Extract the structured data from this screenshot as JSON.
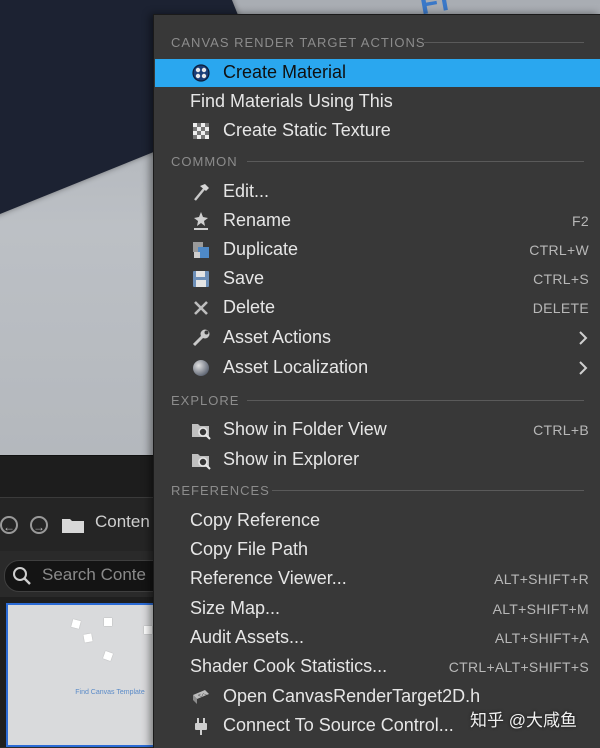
{
  "viewport": {
    "overlay_text": "Fi"
  },
  "content_browser": {
    "path_label": "Conten",
    "search_placeholder": "Search Conte",
    "thumbnail_title": "Find Canvas Template"
  },
  "menu": {
    "sections": [
      {
        "header": "CANVAS RENDER TARGET ACTIONS",
        "items": [
          {
            "label": "Create Material",
            "icon": "create-material-icon",
            "shortcut": "",
            "submenu": false,
            "highlighted": true
          },
          {
            "label": "Find Materials Using This",
            "icon": "",
            "shortcut": "",
            "submenu": false,
            "highlighted": false
          },
          {
            "label": "Create Static Texture",
            "icon": "static-texture-icon",
            "shortcut": "",
            "submenu": false,
            "highlighted": false
          }
        ]
      },
      {
        "header": "COMMON",
        "items": [
          {
            "label": "Edit...",
            "icon": "edit-hammer-icon",
            "shortcut": "",
            "submenu": false
          },
          {
            "label": "Rename",
            "icon": "rename-icon",
            "shortcut": "F2",
            "submenu": false
          },
          {
            "label": "Duplicate",
            "icon": "duplicate-icon",
            "shortcut": "CTRL+W",
            "submenu": false
          },
          {
            "label": "Save",
            "icon": "save-floppy-icon",
            "shortcut": "CTRL+S",
            "submenu": false
          },
          {
            "label": "Delete",
            "icon": "delete-x-icon",
            "shortcut": "DELETE",
            "submenu": false
          },
          {
            "label": "Asset Actions",
            "icon": "wrench-icon",
            "shortcut": "",
            "submenu": true
          },
          {
            "label": "Asset Localization",
            "icon": "globe-icon",
            "shortcut": "",
            "submenu": true
          }
        ]
      },
      {
        "header": "EXPLORE",
        "items": [
          {
            "label": "Show in Folder View",
            "icon": "folder-search-icon",
            "shortcut": "CTRL+B",
            "submenu": false
          },
          {
            "label": "Show in Explorer",
            "icon": "folder-search-icon",
            "shortcut": "",
            "submenu": false
          }
        ]
      },
      {
        "header": "REFERENCES",
        "items": [
          {
            "label": "Copy Reference",
            "icon": "",
            "shortcut": "",
            "submenu": false
          },
          {
            "label": "Copy File Path",
            "icon": "",
            "shortcut": "",
            "submenu": false
          },
          {
            "label": "Reference Viewer...",
            "icon": "",
            "shortcut": "ALT+SHIFT+R",
            "submenu": false
          },
          {
            "label": "Size Map...",
            "icon": "",
            "shortcut": "ALT+SHIFT+M",
            "submenu": false
          },
          {
            "label": "Audit Assets...",
            "icon": "",
            "shortcut": "ALT+SHIFT+A",
            "submenu": false
          },
          {
            "label": "Shader Cook Statistics...",
            "icon": "",
            "shortcut": "CTRL+ALT+SHIFT+S",
            "submenu": false
          },
          {
            "label": "Open CanvasRenderTarget2D.h",
            "icon": "code-file-icon",
            "shortcut": "",
            "submenu": false
          },
          {
            "label": "Connect To Source Control...",
            "icon": "source-control-plug-icon",
            "shortcut": "",
            "submenu": false
          }
        ]
      }
    ]
  },
  "watermark": "知乎 @大咸鱼",
  "colors": {
    "menu_bg": "#383838",
    "highlight": "#2aa7ef",
    "section_text": "#8c8c8c",
    "item_text": "#e6e6e6"
  }
}
